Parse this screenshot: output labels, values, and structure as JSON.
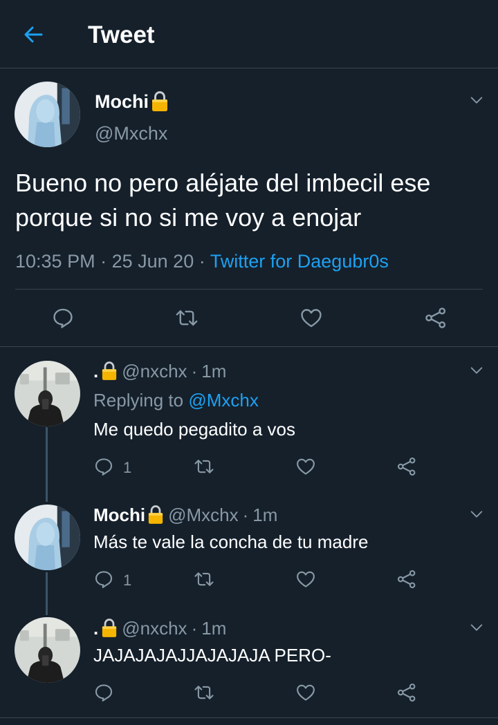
{
  "header": {
    "title": "Tweet"
  },
  "main_tweet": {
    "name": "Mochi",
    "handle": "@Mxchx",
    "text": "Bueno no pero aléjate del imbecil ese porque si no si me voy a enojar",
    "time": "10:35 PM",
    "date": "25 Jun 20",
    "source": "Twitter for Daegubr0s",
    "separator": "·"
  },
  "replies": [
    {
      "name": ".",
      "handle": "@nxchx",
      "age": "1m",
      "replying_prefix": "Replying to",
      "replying_handle": "@Mxchx",
      "text": "Me quedo pegadito a vos",
      "reply_count": "1"
    },
    {
      "name": "Mochi",
      "handle": "@Mxchx",
      "age": "1m",
      "text": "Más te vale la concha de tu madre",
      "reply_count": "1"
    },
    {
      "name": ".",
      "handle": "@nxchx",
      "age": "1m",
      "text": "JAJAJAJAJJAJAJAJA PERO-",
      "reply_count": ""
    }
  ],
  "colors": {
    "background": "#15202b",
    "accent": "#1da1f2",
    "secondary_text": "#8899a6",
    "divider": "#38444d"
  },
  "icons": [
    "back-arrow-icon",
    "lock-icon",
    "chevron-down-icon",
    "reply-icon",
    "retweet-icon",
    "like-icon",
    "share-icon"
  ]
}
